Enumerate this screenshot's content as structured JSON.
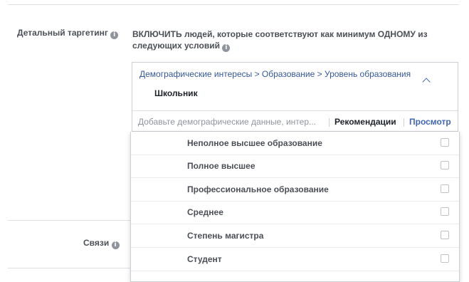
{
  "detailed_targeting": {
    "label": "Детальный таргетинг",
    "description": "ВКЛЮЧИТЬ людей, которые соответствуют как минимум ОДНОМУ из следующих условий",
    "breadcrumb": "Демографические интересы > Образование > Уровень образования",
    "selected": "Школьник",
    "search_placeholder": "Добавьте демографические данные, интер...",
    "recommendations_label": "Рекомендации",
    "browse_label": "Просмотр",
    "options": [
      {
        "label": "Неполное высшее образование",
        "checked": false
      },
      {
        "label": "Полное высшее",
        "checked": false
      },
      {
        "label": "Профессиональное образование",
        "checked": false
      },
      {
        "label": "Среднее",
        "checked": false
      },
      {
        "label": "Степень магистра",
        "checked": false
      },
      {
        "label": "Студент",
        "checked": false
      }
    ]
  },
  "connections": {
    "label": "Связи"
  },
  "icons": {
    "info": "i"
  },
  "colors": {
    "link_blue": "#365899",
    "accent_blue": "#4267b2",
    "label_gray": "#4b4f56"
  }
}
